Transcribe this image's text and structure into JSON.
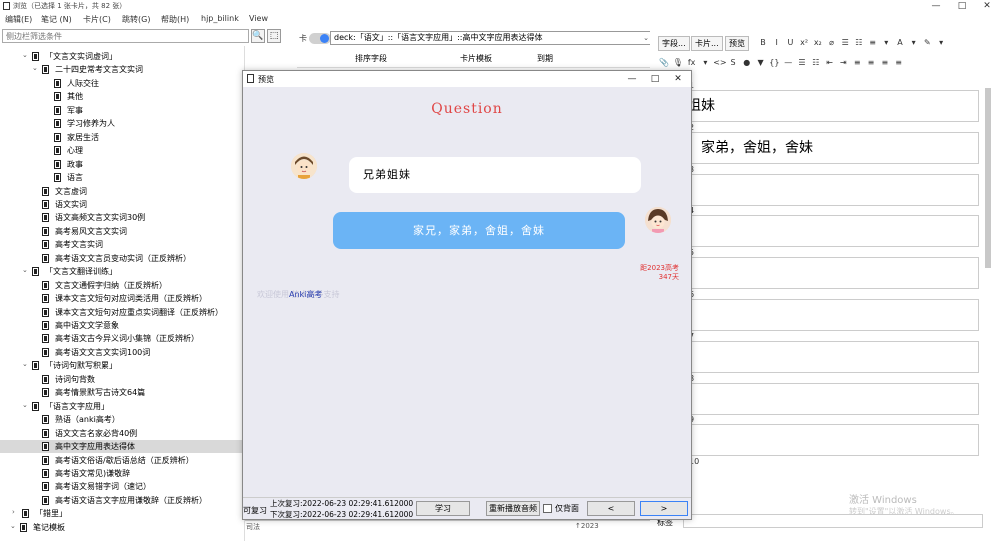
{
  "window": {
    "title": "浏览（已选择 1 张卡片，共 82 张）",
    "min": "—",
    "max": "□",
    "close": "✕"
  },
  "menubar": [
    "编辑(E)",
    "笔记 (N)",
    "卡片(C)",
    "跳转(G)",
    "帮助(H)",
    "hjp_bilink",
    "View"
  ],
  "sidebar": {
    "filter_placeholder": "侧边栏筛选条件",
    "search_icon": "🔍",
    "select_icon": "⬚",
    "tree": [
      {
        "label": "「文言文实词虚词」",
        "level": 1,
        "arrow": "⌄"
      },
      {
        "label": "二十四史常考文言文实词",
        "level": 2,
        "arrow": "⌄"
      },
      {
        "label": "人际交往",
        "level": 3,
        "arrow": ""
      },
      {
        "label": "其他",
        "level": 3,
        "arrow": ""
      },
      {
        "label": "军事",
        "level": 3,
        "arrow": ""
      },
      {
        "label": "学习修养为人",
        "level": 3,
        "arrow": ""
      },
      {
        "label": "家居生活",
        "level": 3,
        "arrow": ""
      },
      {
        "label": "心理",
        "level": 3,
        "arrow": ""
      },
      {
        "label": "政事",
        "level": 3,
        "arrow": ""
      },
      {
        "label": "语言",
        "level": 3,
        "arrow": ""
      },
      {
        "label": "文言虚词",
        "level": 2,
        "arrow": ""
      },
      {
        "label": "语文实词",
        "level": 2,
        "arrow": ""
      },
      {
        "label": "语文高频文言文实词30例",
        "level": 2,
        "arrow": ""
      },
      {
        "label": "高考易风文言文实词",
        "level": 2,
        "arrow": ""
      },
      {
        "label": "高考文言实词",
        "level": 2,
        "arrow": ""
      },
      {
        "label": "高考语文文言员变动实词（正反辨析）",
        "level": 2,
        "arrow": ""
      },
      {
        "label": "「文言文翻译训练」",
        "level": 1,
        "arrow": "⌄"
      },
      {
        "label": "文言文通假字归纳（正反辨析）",
        "level": 2,
        "arrow": ""
      },
      {
        "label": "课本文言文短句对应词类活用（正反辨析）",
        "level": 2,
        "arrow": ""
      },
      {
        "label": "课本文言文短句对应重点实词翻译（正反辨析）",
        "level": 2,
        "arrow": ""
      },
      {
        "label": "高中语文文学意象",
        "level": 2,
        "arrow": ""
      },
      {
        "label": "高考语文古今异义词小集锦（正反辨析）",
        "level": 2,
        "arrow": ""
      },
      {
        "label": "高考语文文言文实词100词",
        "level": 2,
        "arrow": ""
      },
      {
        "label": "「诗词句默写积累」",
        "level": 1,
        "arrow": "⌄"
      },
      {
        "label": "诗词句背数",
        "level": 2,
        "arrow": ""
      },
      {
        "label": "高考情景默写古诗文64篇",
        "level": 2,
        "arrow": ""
      },
      {
        "label": "「语言文字应用」",
        "level": 1,
        "arrow": "⌄"
      },
      {
        "label": "熟语（anki高考）",
        "level": 2,
        "arrow": ""
      },
      {
        "label": "语文文言名家必背40例",
        "level": 2,
        "arrow": ""
      },
      {
        "label": "高中文字应用表达得体",
        "level": 2,
        "arrow": "",
        "selected": true
      },
      {
        "label": "高考语文俗语/歇后语总结（正反辨析）",
        "level": 2,
        "arrow": ""
      },
      {
        "label": "高考语文常见)谦敬辞",
        "level": 2,
        "arrow": ""
      },
      {
        "label": "高考语文易错字词（速记）",
        "level": 2,
        "arrow": ""
      },
      {
        "label": "高考语文语言文字应用谦敬辞（正反辨析）",
        "level": 2,
        "arrow": ""
      },
      {
        "label": "「錯里」",
        "level": 0.5,
        "arrow": "›"
      },
      {
        "label": "笔记模板",
        "level": 0,
        "arrow": "⌄"
      }
    ]
  },
  "browser": {
    "toggle_label": "卡",
    "search_value": "deck:「语文」::「语言文字应用」::高中文字应用表达得体",
    "columns": [
      "排序字段",
      "卡片模板",
      "到期"
    ],
    "bottom_text": "可复习",
    "row_fragments": [
      "□ 仅背面",
      "司法",
      "↑2023"
    ]
  },
  "editor": {
    "buttons": [
      "字段...",
      "卡片...",
      "预览"
    ],
    "field_numbers": [
      "1",
      "2",
      "3",
      "4",
      "5",
      "6",
      "7",
      "8",
      "9",
      "10"
    ],
    "fields": [
      "姐妹",
      "，家弟，舍姐，舍妹",
      "",
      "",
      "",
      "",
      "",
      "",
      "",
      ""
    ],
    "tags_label": "标签",
    "toolbar1": [
      "B",
      "I",
      "U",
      "x²",
      "x₂",
      "⌀",
      "☰",
      "☷",
      "≡",
      "▾",
      "A",
      "▾",
      "✎",
      "▾"
    ],
    "toolbar2": [
      "📎",
      "🎙",
      "fx",
      "▾",
      "<>",
      "S",
      "●",
      "▼",
      "{}",
      "—",
      "☰",
      "☷",
      "⇤",
      "⇥",
      "≡",
      "≡",
      "≡",
      "≡"
    ]
  },
  "preview": {
    "title": "预览",
    "question_label": "Question",
    "question_text": "兄弟姐妹",
    "answer_text": "家兄，家弟，舍姐，舍妹",
    "countdown_line1": "距2023高考",
    "countdown_line2": "347天",
    "faint_text": "欢迎使用               技术更多支持",
    "anki_link": "Anki高考",
    "last_review_1": "上次复习:2022-06-23 02:29:41.612000",
    "last_review_2": "下次复习:2022-06-23 02:29:41.612000",
    "btn_study": "学习",
    "btn_replay": "重新播放音频",
    "chk_back": "仅背面",
    "btn_prev": "<",
    "btn_next": ">"
  },
  "watermark": {
    "line1": "激活 Windows",
    "line2": "转到\"设置\"以激活 Windows。"
  },
  "colors": {
    "question": "#e04646",
    "answer_bubble": "#6bb4f5",
    "selection": "#d9d9d9",
    "toggle_knob": "#3b82f6"
  }
}
